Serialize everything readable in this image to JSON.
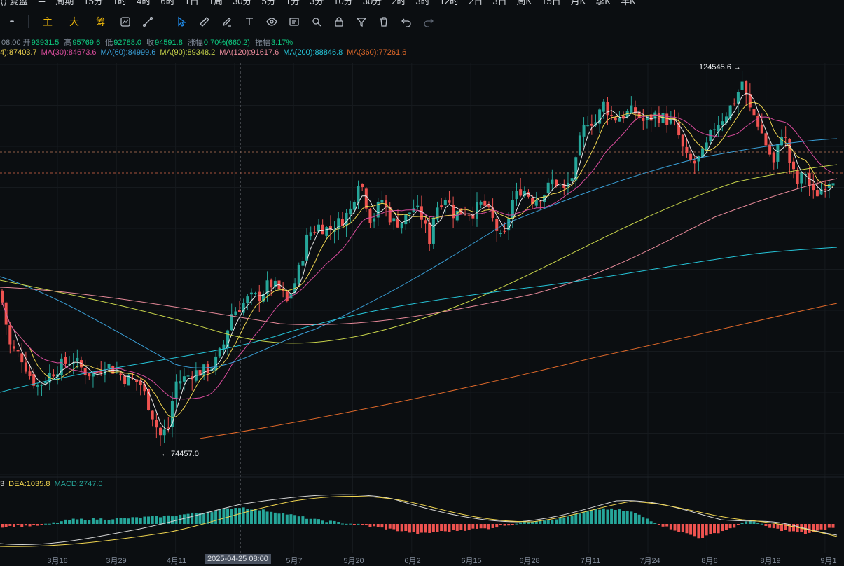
{
  "topbar": {
    "items": [
      "⟨⟩ 复盘",
      "☰",
      "周期",
      "15分",
      "1时",
      "4时",
      "6时",
      "1日",
      "1周",
      "30分",
      "5分",
      "1分",
      "3分",
      "10分",
      "30分",
      "2时",
      "3时",
      "12时",
      "2日",
      "3日",
      "周K",
      "15日",
      "月K",
      "季K",
      "年K"
    ]
  },
  "toolbar": {
    "more_label": "•••",
    "main_label": "主",
    "big_label": "大",
    "chip_label": "筹"
  },
  "ohlc": {
    "time": "08:00",
    "open_label": "开",
    "open": "93931.5",
    "high_label": "高",
    "high": "95769.6",
    "low_label": "低",
    "low": "92788.0",
    "close_label": "收",
    "close": "94591.8",
    "change_label": "涨幅",
    "change": "0.70%(660.2)",
    "amp_label": "振幅",
    "amp": "3.17%"
  },
  "ma_legend": [
    {
      "text": "4):87403.7",
      "color": "#f0d550"
    },
    {
      "text": "MA(30):84673.6",
      "color": "#d94c9c"
    },
    {
      "text": "MA(60):84999.6",
      "color": "#3aa0d8"
    },
    {
      "text": "MA(90):89348.2",
      "color": "#c8d44a"
    },
    {
      "text": "MA(120):91617.6",
      "color": "#e88a9a"
    },
    {
      "text": "MA(200):88846.8",
      "color": "#26c6da"
    },
    {
      "text": "MA(360):77261.6",
      "color": "#e0692a"
    }
  ],
  "macd_legend": [
    {
      "text": "3",
      "color": "#d6d6d6"
    },
    {
      "text": "DEA:1035.8",
      "color": "#f0d550"
    },
    {
      "text": "MACD:2747.0",
      "color": "#26a69a"
    }
  ],
  "annotations": {
    "high": "124545.6 →",
    "low": "← 74457.0"
  },
  "crosshair_date": "2025-04-25 08:00",
  "x_axis": {
    "labels": [
      "3月16",
      "3月29",
      "4月11",
      "5月7",
      "5月20",
      "6月2",
      "6月15",
      "6月28",
      "7月11",
      "7月24",
      "8月6",
      "8月19",
      "9月1"
    ]
  },
  "colors": {
    "up": "#26a69a",
    "down": "#ef5350",
    "background": "#0b0e11",
    "accent": "#f0b90b"
  },
  "chart_data": {
    "type": "candlestick",
    "interval": "1D",
    "price_high": 124545.6,
    "price_low": 74457.0,
    "moving_averages": [
      {
        "name": "MA(30)",
        "value": 84673.6
      },
      {
        "name": "MA(60)",
        "value": 84999.6
      },
      {
        "name": "MA(90)",
        "value": 89348.2
      },
      {
        "name": "MA(120)",
        "value": 91617.6
      },
      {
        "name": "MA(200)",
        "value": 88846.8
      },
      {
        "name": "MA(360)",
        "value": 77261.6
      }
    ],
    "macd": {
      "dea": 1035.8,
      "macd": 2747.0
    },
    "last_bar": {
      "open": 93931.5,
      "high": 95769.6,
      "low": 92788.0,
      "close": 94591.8
    }
  }
}
